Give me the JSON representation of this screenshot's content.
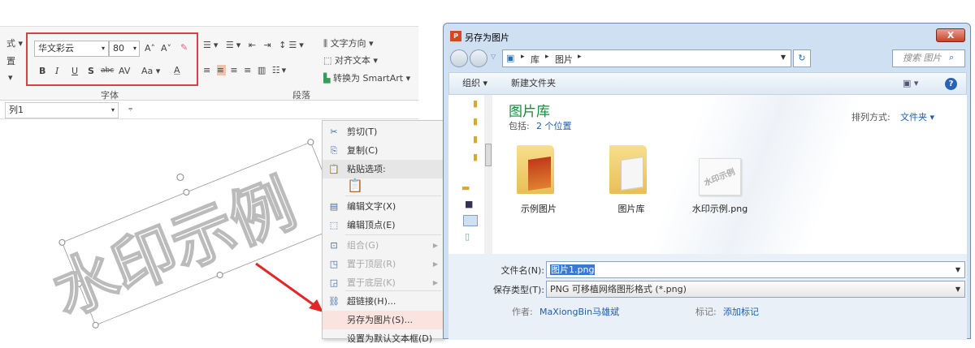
{
  "ribbon": {
    "left_labels": [
      "式 ▾",
      "置",
      "▾"
    ],
    "font_name": "华文彩云",
    "font_size": "80",
    "font_buttons": [
      "B",
      "I",
      "U",
      "S",
      "abc",
      "AV",
      "Aa ▾",
      "A"
    ],
    "grow_icon": "A˄",
    "shrink_icon": "A˅",
    "group_font": "字体",
    "group_paragraph": "段落",
    "text_direction": "文字方向 ▾",
    "align_text": "对齐文本 ▾",
    "convert_smartart": "转换为 SmartArt ▾",
    "style_box_value": "列1"
  },
  "slide": {
    "watermark_text": "水印示例"
  },
  "context_menu": {
    "items": [
      {
        "label": "剪切(T)",
        "icon": "scissors-icon",
        "state": "enabled"
      },
      {
        "label": "复制(C)",
        "icon": "copy-icon",
        "state": "enabled"
      },
      {
        "label": "粘贴选项:",
        "icon": "paste-icon",
        "state": "header"
      },
      {
        "label": "编辑文字(X)",
        "icon": "edit-text-icon",
        "state": "enabled"
      },
      {
        "label": "编辑顶点(E)",
        "icon": "edit-points-icon",
        "state": "enabled"
      },
      {
        "label": "组合(G)",
        "icon": "group-icon",
        "state": "disabled"
      },
      {
        "label": "置于顶层(R)",
        "icon": "bring-front-icon",
        "state": "disabled"
      },
      {
        "label": "置于底层(K)",
        "icon": "send-back-icon",
        "state": "disabled"
      },
      {
        "label": "超链接(H)...",
        "icon": "hyperlink-icon",
        "state": "enabled"
      },
      {
        "label": "另存为图片(S)...",
        "icon": "",
        "state": "highlighted"
      },
      {
        "label": "设置为默认文本框(D)",
        "icon": "",
        "state": "enabled"
      }
    ]
  },
  "dialog": {
    "title": "另存为图片",
    "close": "X",
    "breadcrumb": [
      "库",
      "图片"
    ],
    "search_placeholder": "搜索 图片",
    "organize": "组织 ▾",
    "new_folder": "新建文件夹",
    "library_title": "图片库",
    "includes_label": "包括:",
    "includes_link": "2 个位置",
    "sort_label": "排列方式:",
    "sort_value": "文件夹 ▾",
    "files": [
      {
        "name": "示例图片",
        "type": "folder"
      },
      {
        "name": "图片库",
        "type": "folder"
      },
      {
        "name": "水印示例.png",
        "type": "image"
      }
    ],
    "filename_label": "文件名(N):",
    "filename_value": "图片1.png",
    "filetype_label": "保存类型(T):",
    "filetype_value": "PNG 可移植网络图形格式 (*.png)",
    "author_label": "作者:",
    "author_value": "MaXiongBin马雄斌",
    "tags_label": "标记:",
    "tags_value": "添加标记"
  }
}
